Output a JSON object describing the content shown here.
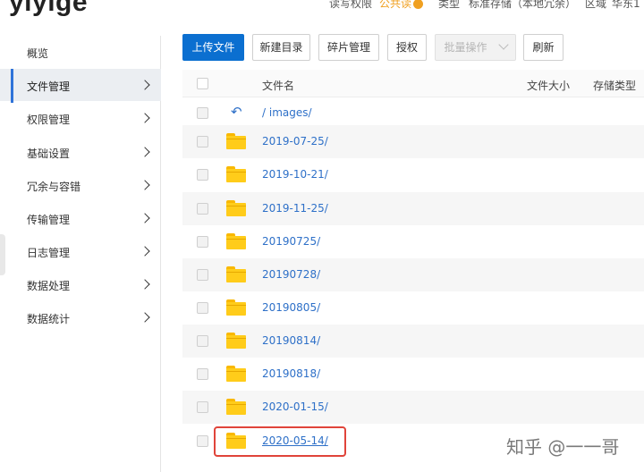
{
  "header": {
    "bucket_name": "yiyige",
    "meta": [
      {
        "label": "读写权限",
        "value": "公共读",
        "value_color": "#f0a020"
      },
      {
        "label": "类型",
        "value": "标准存储（本地冗余）"
      },
      {
        "label": "区域",
        "value": "华东1"
      }
    ]
  },
  "sidebar": {
    "items": [
      {
        "label": "概览",
        "has_chevron": false
      },
      {
        "label": "文件管理",
        "has_chevron": true,
        "active": true
      },
      {
        "label": "权限管理",
        "has_chevron": true
      },
      {
        "label": "基础设置",
        "has_chevron": true
      },
      {
        "label": "冗余与容错",
        "has_chevron": true
      },
      {
        "label": "传输管理",
        "has_chevron": true
      },
      {
        "label": "日志管理",
        "has_chevron": true
      },
      {
        "label": "数据处理",
        "has_chevron": true
      },
      {
        "label": "数据统计",
        "has_chevron": true
      }
    ]
  },
  "toolbar": {
    "upload": "上传文件",
    "new_dir": "新建目录",
    "fragments": "碎片管理",
    "authorize": "授权",
    "batch": "批量操作",
    "refresh": "刷新"
  },
  "table": {
    "columns": {
      "name": "文件名",
      "size": "文件大小",
      "storage": "存储类型"
    },
    "path": "/ images/",
    "rows": [
      {
        "name": "2019-07-25/"
      },
      {
        "name": "2019-10-21/"
      },
      {
        "name": "2019-11-25/"
      },
      {
        "name": "20190725/"
      },
      {
        "name": "20190728/"
      },
      {
        "name": "20190805/"
      },
      {
        "name": "20190814/"
      },
      {
        "name": "20190818/"
      },
      {
        "name": "2020-01-15/"
      },
      {
        "name": "2020-05-14/",
        "highlighted": true
      }
    ]
  },
  "watermark": "知乎 @一一哥",
  "colors": {
    "primary": "#0b6fd0",
    "link": "#2e70c8",
    "folder": "#ffcc1a",
    "highlight": "#e0443a",
    "warning": "#f0a020"
  }
}
